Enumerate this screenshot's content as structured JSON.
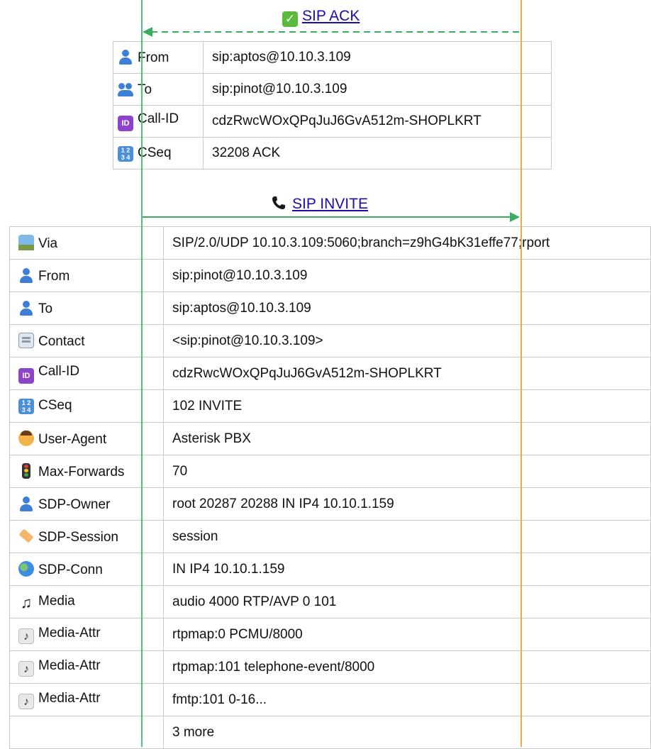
{
  "ack": {
    "label": "SIP ACK",
    "icon": "check-mark-icon",
    "direction": "right-to-left",
    "rows": [
      {
        "icon": "person-icon",
        "key": "From",
        "value": "sip:aptos@10.10.3.109"
      },
      {
        "icon": "persons-icon",
        "key": "To",
        "value": "sip:pinot@10.10.3.109"
      },
      {
        "icon": "id-icon",
        "key": "Call-ID",
        "value": "cdzRwcWOxQPqJuJ6GvA512m-SHOPLKRT"
      },
      {
        "icon": "numbers-icon",
        "key": "CSeq",
        "value": "32208 ACK"
      }
    ]
  },
  "invite": {
    "label": "SIP INVITE",
    "icon": "telephone-icon",
    "direction": "left-to-right",
    "rows": [
      {
        "icon": "railway-icon",
        "key": "Via",
        "value": "SIP/2.0/UDP 10.10.3.109:5060;branch=z9hG4bK31effe77;rport"
      },
      {
        "icon": "person-icon",
        "key": "From",
        "value": "sip:pinot@10.10.3.109"
      },
      {
        "icon": "person-icon",
        "key": "To",
        "value": "sip:aptos@10.10.3.109"
      },
      {
        "icon": "contact-card-icon",
        "key": "Contact",
        "value": "<sip:pinot@10.10.3.109>"
      },
      {
        "icon": "id-icon",
        "key": "Call-ID",
        "value": "cdzRwcWOxQPqJuJ6GvA512m-SHOPLKRT"
      },
      {
        "icon": "numbers-icon",
        "key": "CSeq",
        "value": "102 INVITE"
      },
      {
        "icon": "person-face-icon",
        "key": "User-Agent",
        "value": "Asterisk PBX"
      },
      {
        "icon": "traffic-light-icon",
        "key": "Max-Forwards",
        "value": "70"
      },
      {
        "icon": "person-icon",
        "key": "SDP-Owner",
        "value": "root 20287 20288 IN IP4 10.10.1.159"
      },
      {
        "icon": "label-tag-icon",
        "key": "SDP-Session",
        "value": "session"
      },
      {
        "icon": "globe-icon",
        "key": "SDP-Conn",
        "value": "IN IP4 10.10.1.159"
      },
      {
        "icon": "music-note-icon",
        "key": "Media",
        "value": "audio 4000 RTP/AVP 0 101"
      },
      {
        "icon": "musical-score-icon",
        "key": "Media-Attr",
        "value": "rtpmap:0 PCMU/8000"
      },
      {
        "icon": "musical-score-icon",
        "key": "Media-Attr",
        "value": "rtpmap:101 telephone-event/8000"
      },
      {
        "icon": "musical-score-icon",
        "key": "Media-Attr",
        "value": "fmtp:101 0-16..."
      },
      {
        "icon": "",
        "key": "",
        "value": "3 more"
      }
    ]
  },
  "colors": {
    "left_lifeline": "#4fbf7c",
    "right_lifeline": "#f0a849",
    "ack_arrow": "#3aae5e",
    "invite_arrow": "#3aae5e",
    "link": "#1a0dab",
    "border": "#c9c9c9"
  }
}
